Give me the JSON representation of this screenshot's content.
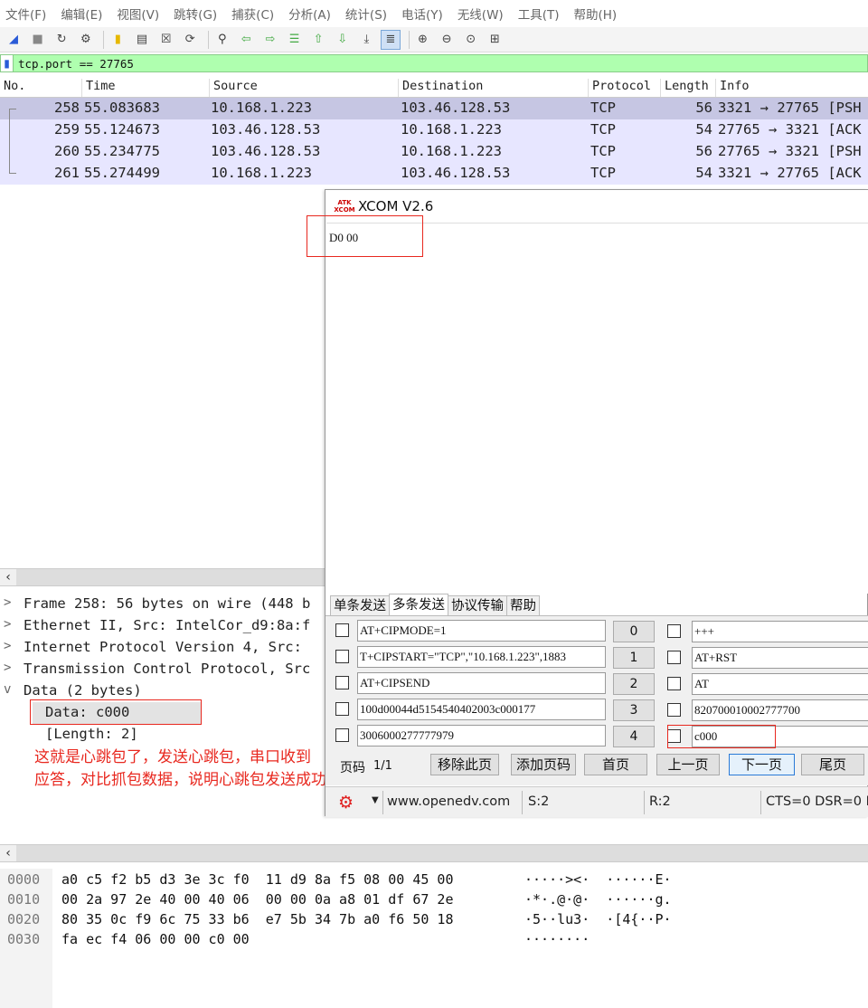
{
  "menu": [
    "文件(F)",
    "编辑(E)",
    "视图(V)",
    "跳转(G)",
    "捕获(C)",
    "分析(A)",
    "统计(S)",
    "电话(Y)",
    "无线(W)",
    "工具(T)",
    "帮助(H)"
  ],
  "toolbar_icons": [
    "shark-fin-start-icon",
    "stop-icon",
    "restart-icon",
    "options-icon",
    "open-folder-icon",
    "file-icon",
    "close-file-icon",
    "reload-icon",
    "find-icon",
    "back-icon",
    "forward-icon",
    "goto-icon",
    "first-icon",
    "last-icon",
    "autoscroll-icon",
    "colorize-icon",
    "zoom-in-icon",
    "zoom-out-icon",
    "zoom-normal-icon",
    "resize-columns-icon"
  ],
  "filter": {
    "text": "tcp.port == 27765"
  },
  "packet_list": {
    "columns": [
      "No.",
      "Time",
      "Source",
      "Destination",
      "Protocol",
      "Length",
      "Info"
    ],
    "rows": [
      {
        "no": "258",
        "time": "55.083683",
        "src": "10.168.1.223",
        "dst": "103.46.128.53",
        "proto": "TCP",
        "len": "56",
        "info": "3321 → 27765 [PSH"
      },
      {
        "no": "259",
        "time": "55.124673",
        "src": "103.46.128.53",
        "dst": "10.168.1.223",
        "proto": "TCP",
        "len": "54",
        "info": "27765 → 3321 [ACK"
      },
      {
        "no": "260",
        "time": "55.234775",
        "src": "103.46.128.53",
        "dst": "10.168.1.223",
        "proto": "TCP",
        "len": "56",
        "info": "27765 → 3321 [PSH"
      },
      {
        "no": "261",
        "time": "55.274499",
        "src": "10.168.1.223",
        "dst": "103.46.128.53",
        "proto": "TCP",
        "len": "54",
        "info": "3321 → 27765 [ACK"
      }
    ]
  },
  "details": [
    {
      "twisty": ">",
      "text": "Frame 258: 56 bytes on wire (448 b"
    },
    {
      "twisty": ">",
      "text": "Ethernet II, Src: IntelCor_d9:8a:f"
    },
    {
      "twisty": ">",
      "text": "Internet Protocol Version 4, Src: "
    },
    {
      "twisty": ">",
      "text": "Transmission Control Protocol, Src"
    },
    {
      "twisty": "v",
      "text": "Data (2 bytes)"
    },
    {
      "twisty": "",
      "text": "Data: c000"
    },
    {
      "twisty": "",
      "text": "[Length: 2]"
    }
  ],
  "annotation": [
    "这就是心跳包了，发送心跳包，串口收到",
    "应答，对比抓包数据，说明心跳包发送成功"
  ],
  "hex": [
    {
      "off": "0000",
      "hex": "a0 c5 f2 b5 d3 3e 3c f0  11 d9 8a f5 08 00 45 00",
      "ascii": "·····><·  ······E·"
    },
    {
      "off": "0010",
      "hex": "00 2a 97 2e 40 00 40 06  00 00 0a a8 01 df 67 2e",
      "ascii": "·*·.@·@·  ······g."
    },
    {
      "off": "0020",
      "hex": "80 35 0c f9 6c 75 33 b6  e7 5b 34 7b a0 f6 50 18",
      "ascii": "·5··lu3·  ·[4{··P·"
    },
    {
      "off": "0030",
      "hex": "fa ec f4 06 00 00 c0 00",
      "ascii": "········"
    }
  ],
  "xcom": {
    "logo_top": "ATK",
    "logo_bottom": "XCOM",
    "title": "XCOM V2.6",
    "received": "D0 00",
    "tabs": [
      "单条发送",
      "多条发送",
      "协议传输",
      "帮助"
    ],
    "left_items": [
      {
        "text": "AT+CIPMODE=1",
        "num": "0"
      },
      {
        "text": "T+CIPSTART=\"TCP\",\"10.168.1.223\",1883",
        "num": "1"
      },
      {
        "text": "AT+CIPSEND",
        "num": "2"
      },
      {
        "text": "100d00044d5154540402003c000177",
        "num": "3"
      },
      {
        "text": "3006000277777979",
        "num": "4"
      }
    ],
    "right_items": [
      "+++",
      "AT+RST",
      "AT",
      "820700010002777700",
      "c000"
    ],
    "page_label": "页码",
    "page_value": "1/1",
    "buttons": [
      "移除此页",
      "添加页码",
      "首页",
      "上一页",
      "下一页",
      "尾页"
    ],
    "status": {
      "url": "www.openedv.com",
      "s": "S:2",
      "r": "R:2",
      "lines": "CTS=0 DSR=0 D"
    }
  }
}
